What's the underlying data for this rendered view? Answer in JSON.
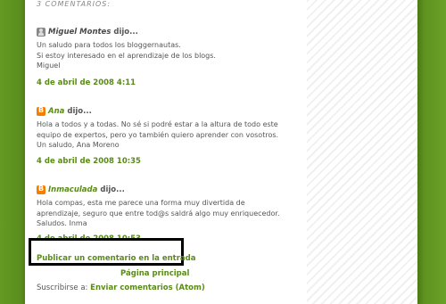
{
  "comments_heading": "3 comentarios:",
  "comments": [
    {
      "icon": "anonymous-user-icon",
      "author": "Miguel Montes",
      "said": "dijo...",
      "body": [
        "Un saludo para todos los bloggernautas.",
        "Si estoy interesado en el aprendizaje de los blogs.",
        "Miguel"
      ],
      "date": "4 de abril de 2008 4:11"
    },
    {
      "icon": "blogger-icon",
      "author": "Ana",
      "said": "dijo...",
      "body": [
        "Hola a todos y a todas. No sé si podré estar a la altura de todo este",
        "equipo de expertos, pero yo también quiero aprender con vosotros.",
        "Un saludo, Ana Moreno"
      ],
      "date": "4 de abril de 2008 10:35"
    },
    {
      "icon": "blogger-icon",
      "author": "Inmaculada",
      "said": "dijo...",
      "body": [
        "Hola compas, esta me parece una forma muy divertida de",
        "aprendizaje, seguro que entre tod@s saldrá algo muy enriquecedor.",
        "Saludos. Inma"
      ],
      "date": "4 de abril de 2008 10:53"
    }
  ],
  "publish_comment": "Publicar un comentario en la entrada",
  "main_page": "Página principal",
  "subscribe_label": "Suscribirse a:",
  "subscribe_link": "Enviar comentarios (Atom)",
  "colors": {
    "background_green": "#5f9320",
    "link_green": "#5a8a1a",
    "highlight_border": "#000000"
  }
}
